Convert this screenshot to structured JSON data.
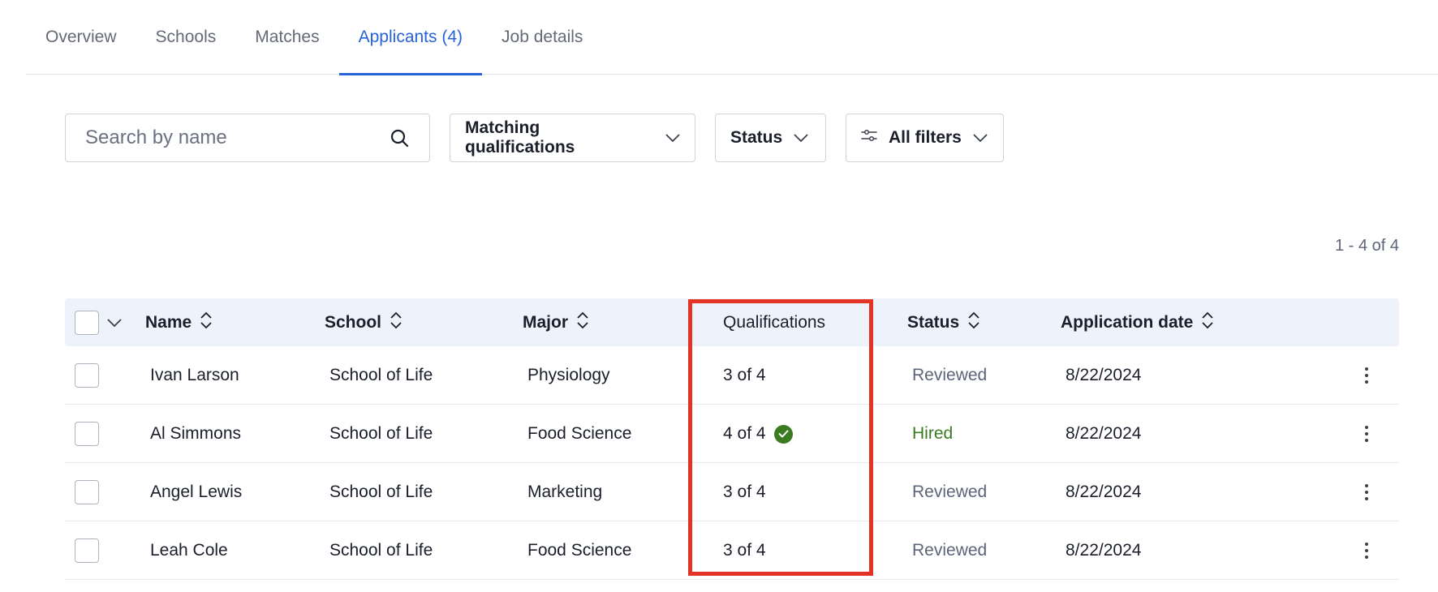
{
  "tabs": [
    {
      "label": "Overview",
      "active": false
    },
    {
      "label": "Schools",
      "active": false
    },
    {
      "label": "Matches",
      "active": false
    },
    {
      "label": "Applicants (4)",
      "active": true
    },
    {
      "label": "Job details",
      "active": false
    }
  ],
  "search": {
    "placeholder": "Search by name",
    "value": "",
    "icon": "search-icon"
  },
  "filters": {
    "qualifications_label": "Matching qualifications",
    "status_label": "Status",
    "all_filters_label": "All filters"
  },
  "pagination": {
    "range": "1 - 4 of 4"
  },
  "table": {
    "columns": {
      "name": "Name",
      "school": "School",
      "major": "Major",
      "qualifications": "Qualifications",
      "status": "Status",
      "application_date": "Application date"
    },
    "rows": [
      {
        "name": "Ivan Larson",
        "school": "School of Life",
        "major": "Physiology",
        "qualifications": "3 of 4",
        "full_match": false,
        "status": "Reviewed",
        "date": "8/22/2024"
      },
      {
        "name": "Al Simmons",
        "school": "School of Life",
        "major": "Food Science",
        "qualifications": "4 of 4",
        "full_match": true,
        "status": "Hired",
        "date": "8/22/2024"
      },
      {
        "name": "Angel Lewis",
        "school": "School of Life",
        "major": "Marketing",
        "qualifications": "3 of 4",
        "full_match": false,
        "status": "Reviewed",
        "date": "8/22/2024"
      },
      {
        "name": "Leah Cole",
        "school": "School of Life",
        "major": "Food Science",
        "qualifications": "3 of 4",
        "full_match": false,
        "status": "Reviewed",
        "date": "8/22/2024"
      }
    ]
  },
  "colors": {
    "accent": "#2563d6",
    "hired": "#3c7a22",
    "highlight": "#e23324",
    "header_bg": "#eef2fa"
  }
}
